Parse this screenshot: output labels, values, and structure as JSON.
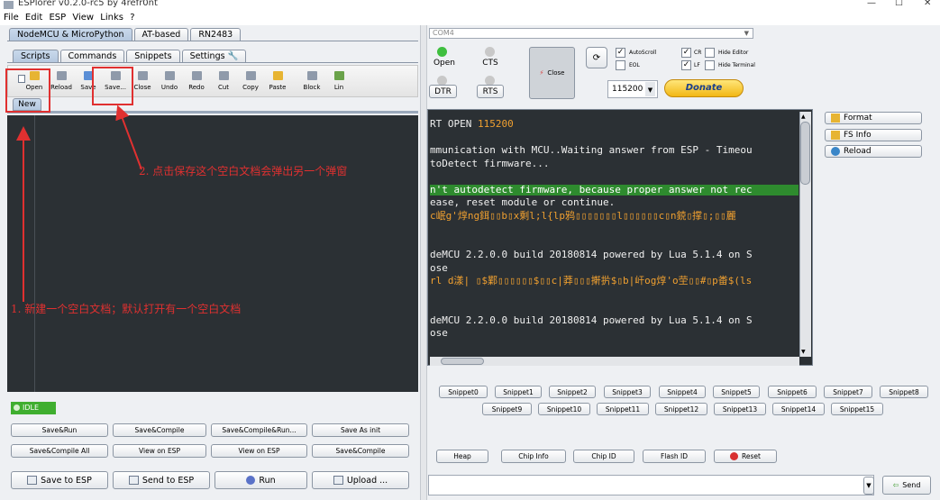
{
  "window": {
    "title": "ESPlorer v0.2.0-rc5 by 4refr0nt",
    "minimize": "—",
    "maximize": "☐",
    "close": "✕"
  },
  "menu": [
    "File",
    "Edit",
    "ESP",
    "View",
    "Links",
    "?"
  ],
  "left": {
    "main_tabs": [
      "NodeMCU & MicroPython",
      "AT-based",
      "RN2483"
    ],
    "sub_tabs": [
      "Scripts",
      "Commands",
      "Snippets",
      "Settings"
    ],
    "toolbar": [
      "Open",
      "Reload",
      "Save",
      "Save...",
      "Close",
      "Undo",
      "Redo",
      "Cut",
      "Copy",
      "Paste",
      "Block",
      "Lin"
    ],
    "file_tab": "New",
    "annotations": {
      "save_note": "2. 点击保存这个空白文档会弹出另一个弹窗",
      "new_note": "1. 新建一个空白文档；默认打开有一个空白文档"
    },
    "status": "IDLE",
    "buttons_row1": [
      "Save&Run",
      "Save&Compile",
      "Save&Compile&Run...",
      "Save As init"
    ],
    "buttons_row2": [
      "Save&Compile All",
      "View on ESP",
      "View on ESP",
      "Save&Compile"
    ],
    "buttons_row3": [
      "Save to ESP",
      "Send to ESP",
      "Run",
      "Upload ..."
    ]
  },
  "right": {
    "port": "COM4",
    "open_label": "Open",
    "cts_label": "CTS",
    "dtr_label": "DTR",
    "rts_label": "RTS",
    "close_label": "Close",
    "baud": "115200",
    "donate": "Donate",
    "checkboxes": {
      "autoscroll": "AutoScroll",
      "cr": "CR",
      "hide_editor": "Hide Editor",
      "eol": "EOL",
      "lf": "LF",
      "hide_terminal": "Hide Terminal"
    },
    "console_lines": [
      {
        "text": "RT OPEN ",
        "accent": "115200",
        "color": "#f0f0f0",
        "bg": ""
      },
      {
        "text": "",
        "accent": "",
        "color": "#f0f0f0",
        "bg": ""
      },
      {
        "text": "mmunication with MCU..Waiting answer from ESP - Timeou",
        "accent": "",
        "color": "#f0f0f0",
        "bg": ""
      },
      {
        "text": "toDetect firmware...",
        "accent": "",
        "color": "#f0f0f0",
        "bg": ""
      },
      {
        "text": "",
        "accent": "",
        "color": "#f0f0f0",
        "bg": ""
      },
      {
        "text": "n't autodetect firmware, because proper answer not rec",
        "accent": "",
        "color": "#ffffff",
        "bg": "#2e8b2e"
      },
      {
        "text": "ease, reset module or continue.",
        "accent": "",
        "color": "#f0f0f0",
        "bg": ""
      },
      {
        "text": "c岷g'焞ng鉺▯▯b▯x剩l;l{lp鸦▯▯▯▯▯▯▯l▯▯▯▯▯▯c▯n鋴▯撑▯;▯▯麗",
        "accent": "",
        "color": "#f0a030",
        "bg": ""
      },
      {
        "text": "",
        "accent": "",
        "color": "#f0f0f0",
        "bg": ""
      },
      {
        "text": "",
        "accent": "",
        "color": "#f0f0f0",
        "bg": ""
      },
      {
        "text": "deMCU 2.2.0.0 build 20180814 powered by Lua 5.1.4 on S",
        "accent": "",
        "color": "#f0f0f0",
        "bg": ""
      },
      {
        "text": "ose",
        "accent": "",
        "color": "#f0f0f0",
        "bg": ""
      },
      {
        "text": "rl d漾| ▯$鄴▯▯▯▯▯▯$▯▯c|莽▯▯▯搟扸$▯b|屽og焞'o茔▯▯#▯p畨$(ls",
        "accent": "",
        "color": "#f0a030",
        "bg": ""
      },
      {
        "text": "",
        "accent": "",
        "color": "#f0f0f0",
        "bg": ""
      },
      {
        "text": "",
        "accent": "",
        "color": "#f0f0f0",
        "bg": ""
      },
      {
        "text": "deMCU 2.2.0.0 build 20180814 powered by Lua 5.1.4 on S",
        "accent": "",
        "color": "#f0f0f0",
        "bg": ""
      },
      {
        "text": "ose",
        "accent": "",
        "color": "#f0f0f0",
        "bg": ""
      }
    ],
    "side_buttons": [
      "Format",
      "FS Info",
      "Reload"
    ],
    "snippets_row1": [
      "Snippet0",
      "Snippet1",
      "Snippet2",
      "Snippet3",
      "Snippet4",
      "Snippet5",
      "Snippet6",
      "Snippet7",
      "Snippet8"
    ],
    "snippets_row2": [
      "Snippet9",
      "Snippet10",
      "Snippet11",
      "Snippet12",
      "Snippet13",
      "Snippet14",
      "Snippet15"
    ],
    "bottom_buttons": [
      "Heap",
      "Chip Info",
      "Chip ID",
      "Flash ID",
      "Reset"
    ],
    "send_label": "Send",
    "command_value": ""
  },
  "colors": {
    "annotation_red": "#e03030",
    "console_bg": "#2b3034",
    "status_green": "#3fae2f",
    "donate_yellow": "#f7c81e"
  }
}
